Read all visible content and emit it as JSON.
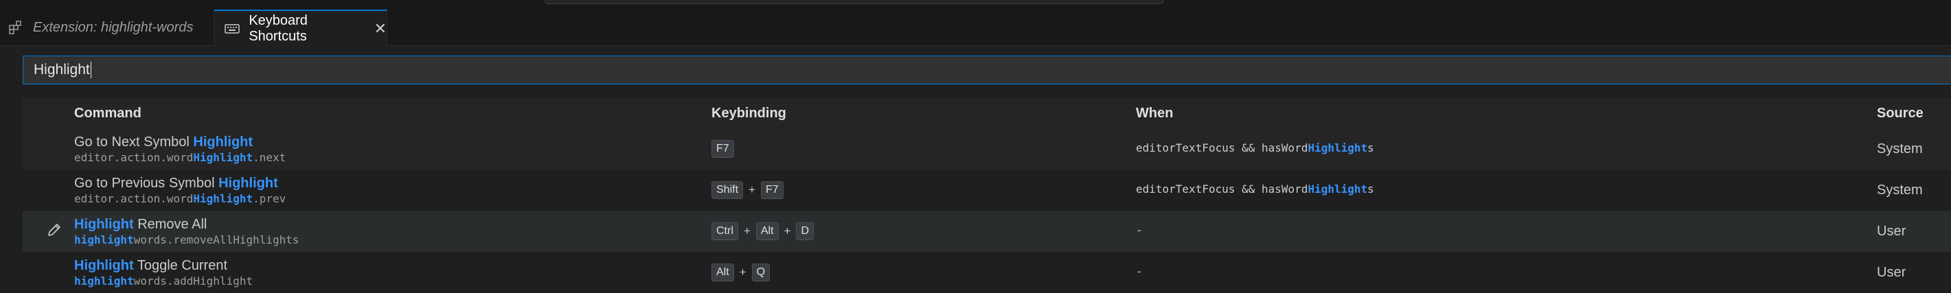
{
  "tabs": [
    {
      "label": "Extension: highlight-words",
      "active": false
    },
    {
      "label": "Keyboard Shortcuts",
      "active": true
    }
  ],
  "search": {
    "value": "Highlight"
  },
  "headers": {
    "command": "Command",
    "keybinding": "Keybinding",
    "when": "When",
    "source": "Source"
  },
  "rows": [
    {
      "title_hl": "",
      "title_hl_after": "Highlight",
      "title_plain": "Go to Next Symbol ",
      "id_pre": "editor.action.word",
      "id_hl": "Highlight",
      "id_post": ".next",
      "keys": [
        "F7"
      ],
      "when_pre": "editorTextFocus && hasWord",
      "when_hl": "Highlight",
      "when_post": "s",
      "source": "System"
    },
    {
      "title_plain": "Go to Previous Symbol ",
      "title_hl_after": "Highlight",
      "id_pre": "editor.action.word",
      "id_hl": "Highlight",
      "id_post": ".prev",
      "keys": [
        "Shift",
        "F7"
      ],
      "when_pre": "editorTextFocus && hasWord",
      "when_hl": "Highlight",
      "when_post": "s",
      "source": "System"
    },
    {
      "title_hl": "Highlight",
      "title_post": " Remove All",
      "id_hl": "highlight",
      "id_post": "words.removeAllHighlights",
      "keys": [
        "Ctrl",
        "Alt",
        "D"
      ],
      "when": "-",
      "source": "User"
    },
    {
      "title_hl": "Highlight",
      "title_post": " Toggle Current",
      "id_hl": "highlight",
      "id_post": "words.addHighlight",
      "keys": [
        "Alt",
        "Q"
      ],
      "when": "-",
      "source": "User"
    }
  ],
  "colors": {
    "accent": "#0078d4",
    "highlight": "#3794ff",
    "background": "#1f1f1f"
  }
}
